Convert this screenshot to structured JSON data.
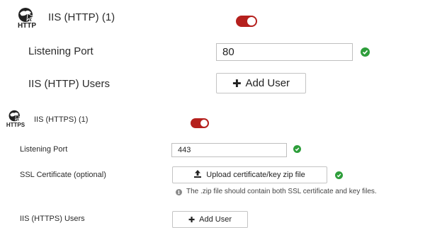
{
  "http": {
    "icon": "globe-cursor-icon",
    "icon_caption": "HTTP",
    "title": "IIS (HTTP) (1)",
    "enabled": true,
    "listening_port_label": "Listening Port",
    "listening_port_value": "80",
    "users_label": "IIS (HTTP) Users",
    "add_user_label": "Add User"
  },
  "https": {
    "icon": "globe-cursor-icon",
    "icon_caption": "HTTPS",
    "title": "IIS (HTTPS) (1)",
    "enabled": true,
    "listening_port_label": "Listening Port",
    "listening_port_value": "443",
    "ssl_label": "SSL Certificate (optional)",
    "upload_label": "Upload certificate/key zip file",
    "info_text": "The .zip file should contain both SSL certificate and key files.",
    "users_label": "IIS (HTTPS) Users",
    "add_user_label": "Add User"
  },
  "colors": {
    "toggle_on": "#b5201d",
    "valid_check": "#2e9e3b"
  }
}
